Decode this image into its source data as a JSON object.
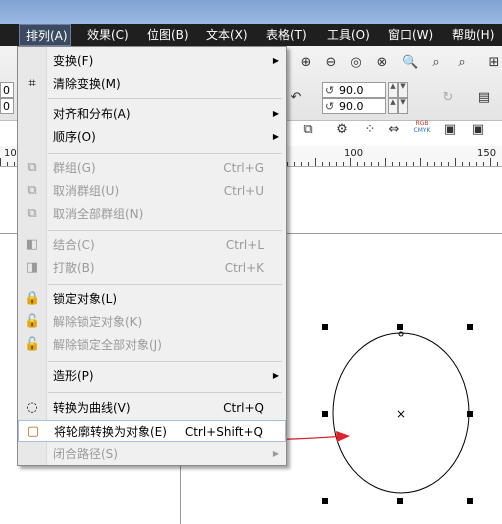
{
  "menubar": {
    "items": [
      {
        "label": "排列(A)",
        "active": true
      },
      {
        "label": "效果(C)"
      },
      {
        "label": "位图(B)"
      },
      {
        "label": "文本(X)"
      },
      {
        "label": "表格(T)"
      },
      {
        "label": "工具(O)"
      },
      {
        "label": "窗口(W)"
      },
      {
        "label": "帮助(H)"
      }
    ]
  },
  "toolbar": {
    "rotation_1": "90.0",
    "rotation_2": "90.0",
    "field_a": "0",
    "field_b": "0",
    "color_button_label_top": "RGB",
    "color_button_label_bottom": "CMYK"
  },
  "ruler": {
    "labels": [
      "10",
      "100",
      "150"
    ]
  },
  "menu": {
    "items": [
      {
        "label": "变换(F)",
        "shortcut": "",
        "submenu": true,
        "disabled": false,
        "icon": ""
      },
      {
        "label": "清除变换(M)",
        "shortcut": "",
        "submenu": false,
        "disabled": false,
        "icon": "clear-transform-icon"
      },
      {
        "label": "对齐和分布(A)",
        "shortcut": "",
        "submenu": true,
        "disabled": false,
        "icon": ""
      },
      {
        "label": "顺序(O)",
        "shortcut": "",
        "submenu": true,
        "disabled": false,
        "icon": ""
      },
      {
        "label": "群组(G)",
        "shortcut": "Ctrl+G",
        "submenu": false,
        "disabled": true,
        "icon": "group-icon"
      },
      {
        "label": "取消群组(U)",
        "shortcut": "Ctrl+U",
        "submenu": false,
        "disabled": true,
        "icon": "ungroup-icon"
      },
      {
        "label": "取消全部群组(N)",
        "shortcut": "",
        "submenu": false,
        "disabled": true,
        "icon": "ungroup-all-icon"
      },
      {
        "label": "结合(C)",
        "shortcut": "Ctrl+L",
        "submenu": false,
        "disabled": true,
        "icon": "combine-icon"
      },
      {
        "label": "打散(B)",
        "shortcut": "Ctrl+K",
        "submenu": false,
        "disabled": true,
        "icon": "break-apart-icon"
      },
      {
        "label": "锁定对象(L)",
        "shortcut": "",
        "submenu": false,
        "disabled": false,
        "icon": "lock-icon"
      },
      {
        "label": "解除锁定对象(K)",
        "shortcut": "",
        "submenu": false,
        "disabled": true,
        "icon": "unlock-icon"
      },
      {
        "label": "解除锁定全部对象(J)",
        "shortcut": "",
        "submenu": false,
        "disabled": true,
        "icon": "unlock-all-icon"
      },
      {
        "label": "造形(P)",
        "shortcut": "",
        "submenu": true,
        "disabled": false,
        "icon": ""
      },
      {
        "label": "转换为曲线(V)",
        "shortcut": "Ctrl+Q",
        "submenu": false,
        "disabled": false,
        "icon": "convert-to-curves-icon"
      },
      {
        "label": "将轮廓转换为对象(E)",
        "shortcut": "Ctrl+Shift+Q",
        "submenu": false,
        "disabled": false,
        "icon": "outline-to-object-icon",
        "highlighted": true
      },
      {
        "label": "闭合路径(S)",
        "shortcut": "",
        "submenu": true,
        "disabled": true,
        "icon": ""
      }
    ]
  },
  "colors": {
    "menubar_bg": "#1f1f1f",
    "annotation_red": "#e0202a",
    "menu_bg": "#f0f0f0"
  }
}
